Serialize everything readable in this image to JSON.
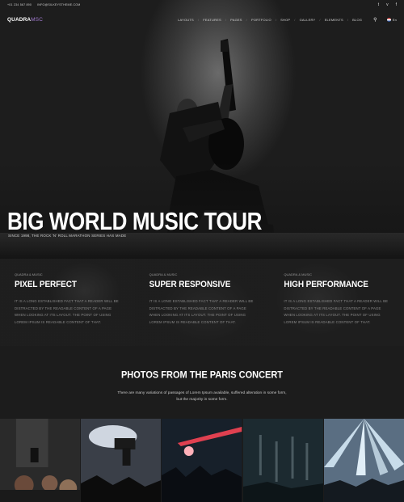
{
  "topbar": {
    "phone": "+01 234 567 890",
    "email": "INFO@SILKEYSTHEME.COM",
    "social": [
      {
        "icon": "twitter-icon",
        "glyph": "t"
      },
      {
        "icon": "vimeo-icon",
        "glyph": "v"
      },
      {
        "icon": "facebook-icon",
        "glyph": "f"
      }
    ]
  },
  "nav": {
    "logo_main": "QUADRA",
    "logo_sub": "MSC",
    "items": [
      "LAYOUTS",
      "FEATURES",
      "PAGES",
      "PORTFOLIO",
      "SHOP",
      "GALLERY",
      "ELEMENTS",
      "BLOG"
    ],
    "language": "En"
  },
  "hero": {
    "title": "BIG WORLD MUSIC TOUR",
    "subtitle": "SINCE 1998, THE ROCK 'N' ROLL MARATHON SERIES HAS MADE"
  },
  "features": [
    {
      "kicker": "QUADRA & MUSIC",
      "title": "PIXEL PERFECT",
      "text": "IT IS A LONG ESTABLISHED FACT THAT A READER WILL BE DISTRACTED BY THE READABLE CONTENT OF A PAGE WHEN LOOKING AT ITS LAYOUT. THE POINT OF USING LOREM IPSUM IS READABLE CONTENT OF THAT."
    },
    {
      "kicker": "QUADRA & MUSIC",
      "title": "SUPER RESPONSIVE",
      "text": "IT IS A LONG ESTABLISHED FACT THAT A READER WILL BE DISTRACTED BY THE READABLE CONTENT OF A PAGE WHEN LOOKING AT ITS LAYOUT. THE POINT OF USING LOREM IPSUM IS READABLE CONTENT OF THAT."
    },
    {
      "kicker": "QUADRA & MUSIC",
      "title": "HIGH PERFORMANCE",
      "text": "IT IS A LONG ESTABLISHED FACT THAT A READER WILL BE DISTRACTED BY THE READABLE CONTENT OF A PAGE WHEN LOOKING AT ITS LAYOUT. THE POINT OF USING LOREM IPSUM IS READABLE CONTENT OF THAT."
    }
  ],
  "photos": {
    "title": "PHOTOS FROM THE PARIS CONCERT",
    "desc_line1": "There are many variations of passages of Lorem Ipsum available, suffered alteration in some form,",
    "desc_line2": "but the majority in some form."
  },
  "colors": {
    "accent": "#a27bd0",
    "background": "#1c1c1c"
  }
}
